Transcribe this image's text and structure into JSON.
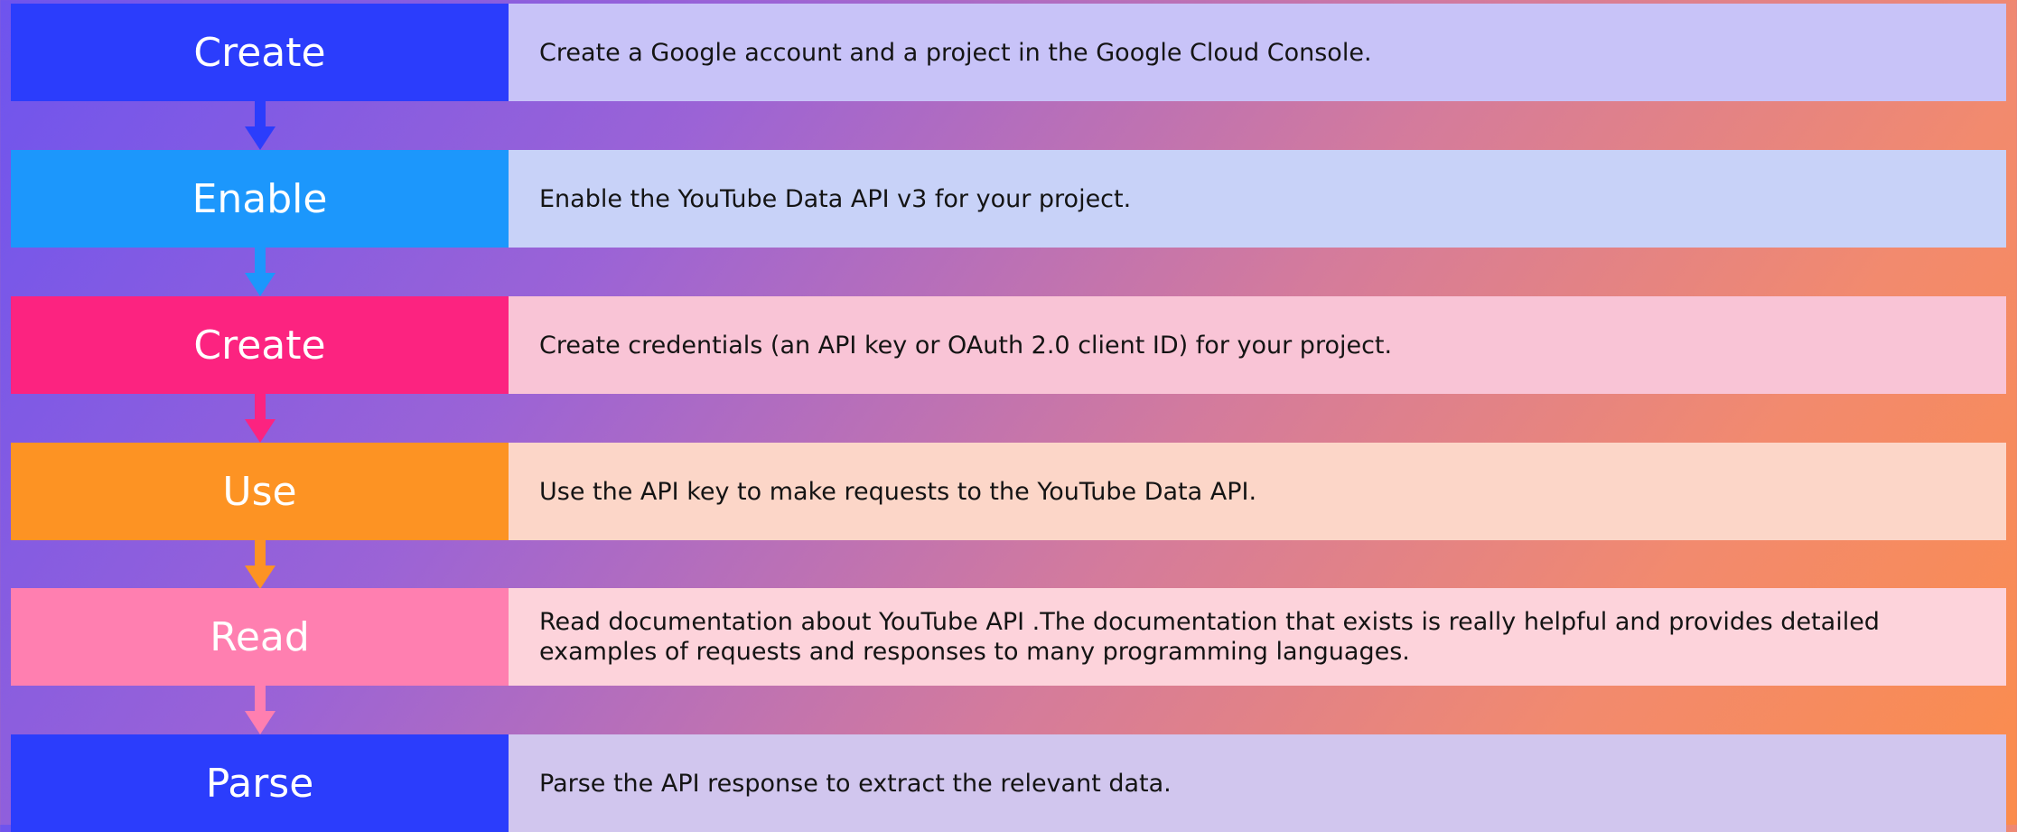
{
  "steps": [
    {
      "label": "Create",
      "description": "Create a Google account and a project in the Google Cloud Console.",
      "label_color": "#2b3dfc",
      "desc_color": "#c8c3f8"
    },
    {
      "label": "Enable",
      "description": "Enable the YouTube Data API v3 for your project.",
      "label_color": "#1c97fc",
      "desc_color": "#c8d2f8"
    },
    {
      "label": "Create",
      "description": "Create credentials (an API key or OAuth 2.0 client ID) for your project.",
      "label_color": "#fc2380",
      "desc_color": "#f9c4d6"
    },
    {
      "label": "Use",
      "description": "Use the API key to make requests to the YouTube Data API.",
      "label_color": "#fd9323",
      "desc_color": "#fcd6c8"
    },
    {
      "label": "Read",
      "description": "Read documentation about YouTube API .The documentation that exists is really  helpful and provides detailed examples of requests and responses to many programming languages.",
      "label_color": "#ff7fb0",
      "desc_color": "#fdd3db"
    },
    {
      "label": "Parse",
      "description": "Parse the API response to extract the relevant data.",
      "label_color": "#2b3dfc",
      "desc_color": "#d1c6ee"
    }
  ]
}
